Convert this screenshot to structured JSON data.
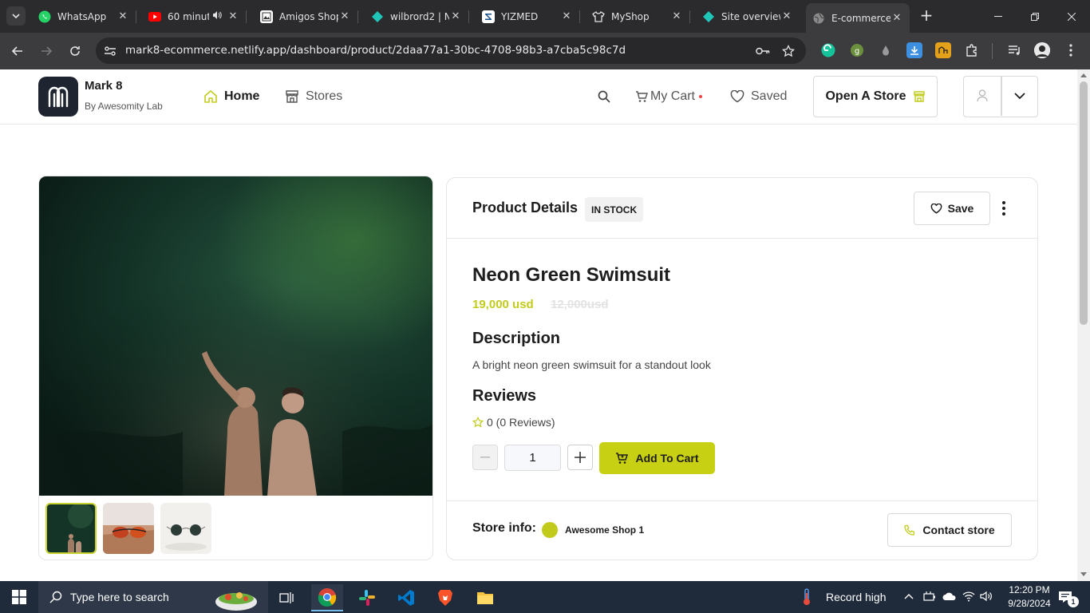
{
  "browser": {
    "tabs": [
      {
        "title": "WhatsApp",
        "favicon": "whatsapp-icon",
        "active": false
      },
      {
        "title": "60 minut",
        "favicon": "youtube-icon",
        "active": false,
        "audio": true
      },
      {
        "title": "Amigos Shop",
        "favicon": "amigos-shop-icon",
        "active": false
      },
      {
        "title": "wilbrord2 | N",
        "favicon": "netlify-icon",
        "active": false
      },
      {
        "title": "YIZMED",
        "favicon": "yizmed-icon",
        "active": false
      },
      {
        "title": "MyShop",
        "favicon": "shirt-icon",
        "active": false
      },
      {
        "title": "Site overview",
        "favicon": "netlify-icon",
        "active": false
      },
      {
        "title": "E-commerce",
        "favicon": "globe-icon",
        "active": true
      }
    ],
    "url": "mark8-ecommerce.netlify.app/dashboard/product/2daa77a1-30bc-4708-98b3-a7cba5c98c7d"
  },
  "site": {
    "brand_name": "Mark 8",
    "brand_sub": "By Awesomity Lab",
    "nav": {
      "home": "Home",
      "stores": "Stores"
    },
    "header_actions": {
      "cart": "My Cart",
      "saved": "Saved",
      "open_store": "Open A Store"
    }
  },
  "product": {
    "card_title": "Product Details",
    "stock_badge": "IN STOCK",
    "save_label": "Save",
    "name": "Neon Green Swimsuit",
    "price": "19,000 usd",
    "old_price": "12,000usd",
    "description_heading": "Description",
    "description": "A bright neon green swimsuit for a standout look",
    "reviews_heading": "Reviews",
    "rating_text": "0 (0 Reviews)",
    "quantity": "1",
    "add_to_cart": "Add To Cart",
    "store_info_label": "Store info:",
    "store_name": "Awesome Shop 1",
    "contact_store": "Contact store",
    "thumbnails": [
      "cave-photo",
      "sunglasses-beach-photo",
      "sunglasses-white-photo"
    ]
  },
  "taskbar": {
    "search_placeholder": "Type here to search",
    "weather": "Record high",
    "time": "12:20 PM",
    "date": "9/28/2024",
    "notification_count": "1"
  },
  "colors": {
    "accent": "#c7d012",
    "price": "#c2cb1c",
    "dark": "#1e2530"
  }
}
